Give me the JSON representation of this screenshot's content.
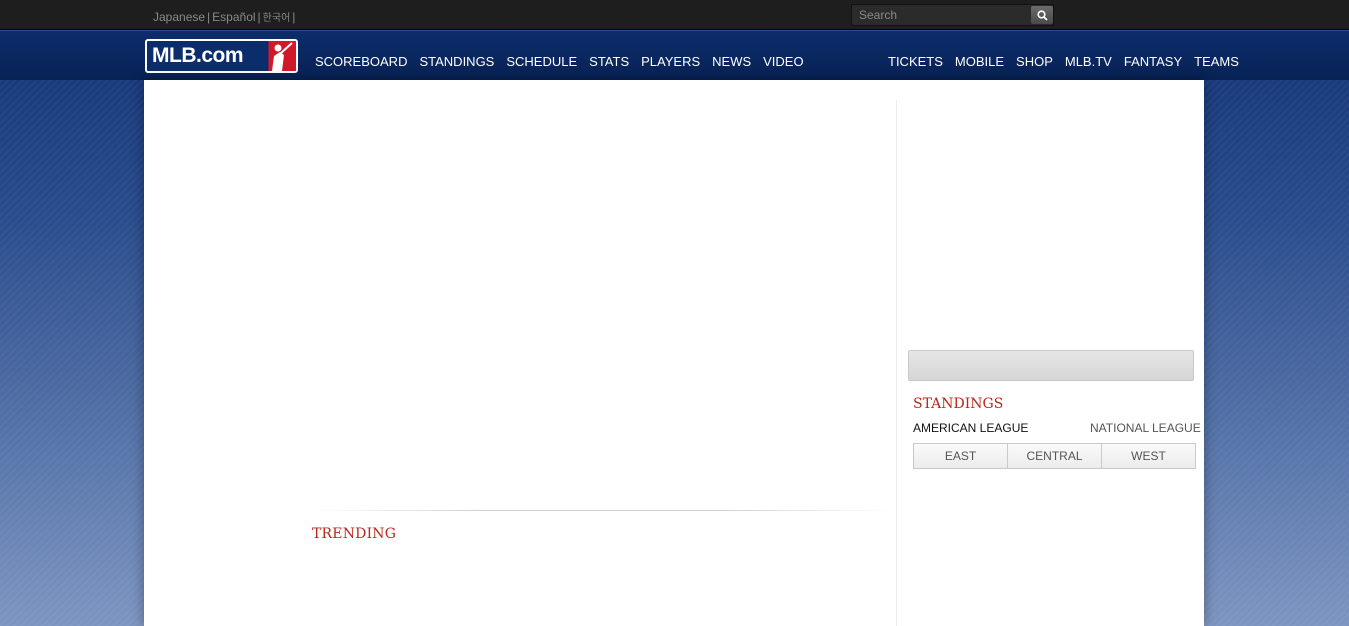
{
  "topbar": {
    "languages": [
      "Japanese",
      "Español",
      "한국어"
    ],
    "search": {
      "placeholder": "Search",
      "value": ""
    }
  },
  "logo": {
    "text": "MLB.com"
  },
  "nav": {
    "left": [
      "SCOREBOARD",
      "STANDINGS",
      "SCHEDULE",
      "STATS",
      "PLAYERS",
      "NEWS",
      "VIDEO"
    ],
    "right": [
      "TICKETS",
      "MOBILE",
      "SHOP",
      "MLB.TV",
      "FANTASY",
      "TEAMS"
    ]
  },
  "main": {
    "trending_title": "TRENDING"
  },
  "sidebar": {
    "standings_title": "STANDINGS",
    "leagues": {
      "american": "AMERICAN LEAGUE",
      "national": "NATIONAL LEAGUE"
    },
    "divisions": [
      "EAST",
      "CENTRAL",
      "WEST"
    ]
  },
  "colors": {
    "accent_red": "#b8271a",
    "nav_blue": "#0c2d6b",
    "topbar": "#1e1e1e"
  }
}
